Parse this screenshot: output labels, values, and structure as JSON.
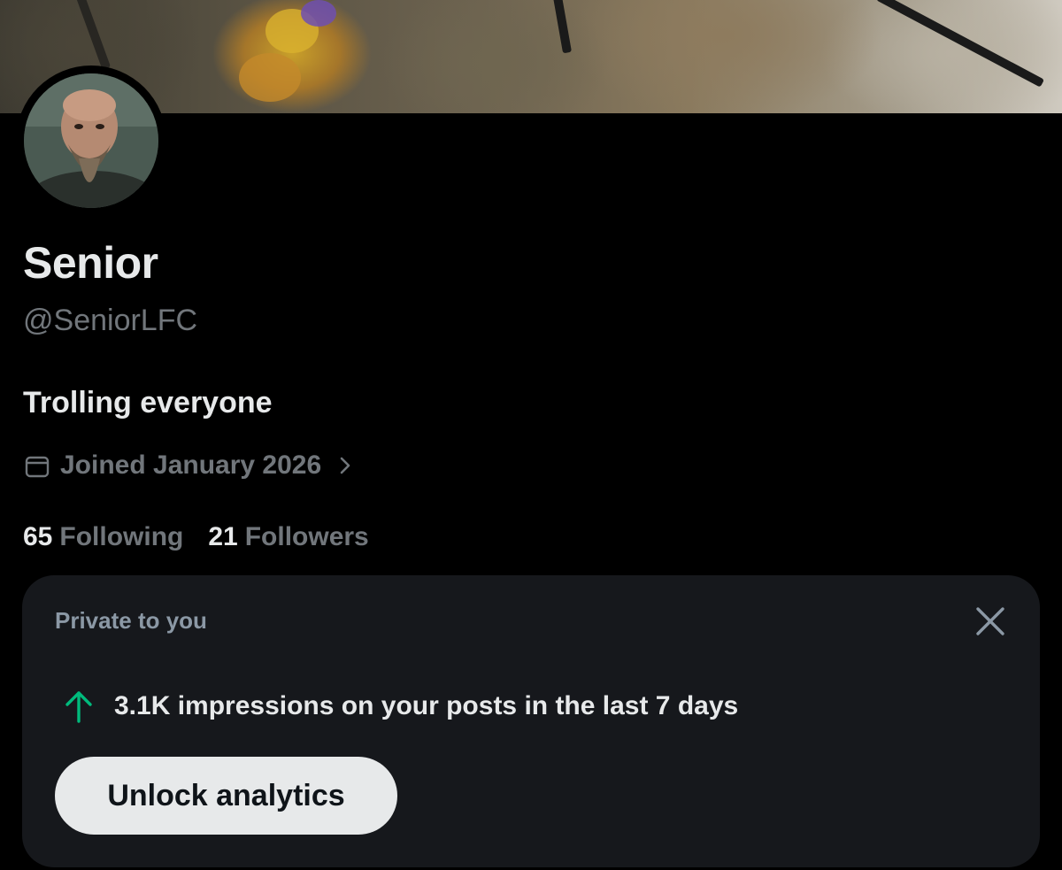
{
  "profile": {
    "display_name": "Senior",
    "handle": "@SeniorLFC",
    "bio": "Trolling everyone",
    "joined": "Joined January 2026",
    "following_count": "65",
    "following_label": "Following",
    "followers_count": "21",
    "followers_label": "Followers"
  },
  "analytics_card": {
    "private_label": "Private to you",
    "impressions_text": "3.1K impressions on your posts in the last 7 days",
    "unlock_button": "Unlock analytics"
  },
  "icons": {
    "calendar": "calendar-icon",
    "chevron": "chevron-right-icon",
    "close": "close-icon",
    "trend": "arrow-up-icon"
  },
  "colors": {
    "background": "#000000",
    "card_background": "#16181c",
    "primary_text": "#e7e9ea",
    "secondary_text": "#71767b",
    "private_label": "#8b98a5",
    "trend_up": "#00ba7c",
    "button_background": "#e7e9ea"
  }
}
